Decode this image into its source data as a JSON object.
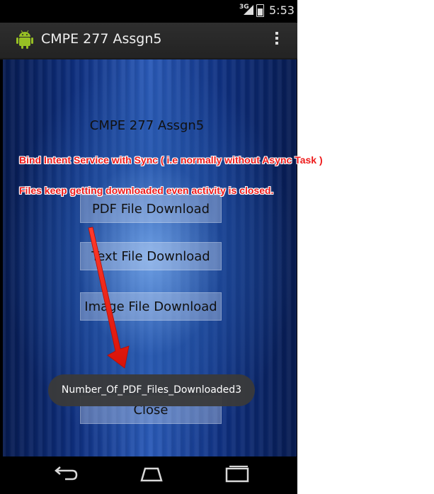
{
  "status_bar": {
    "network": "3G",
    "time": "5:53"
  },
  "action_bar": {
    "title": "CMPE 277 Assgn5"
  },
  "content": {
    "title": "CMPE 277 Assgn5",
    "buttons": {
      "pdf": "PDF File Download",
      "text": "Text File Download",
      "image": "Image File Download",
      "close": "Close"
    }
  },
  "toast": {
    "message": "Number_Of_PDF_Files_Downloaded3"
  },
  "annotations": {
    "line1": "Bind Intent Service with Sync ( i.e normally without Async Task )",
    "line2": "Files keep getting downloaded even activity is closed."
  },
  "colors": {
    "annotation": "#ee1a1a",
    "android_green": "#97c024",
    "background_blue": "#2a5ab8"
  },
  "icons": [
    "android-icon",
    "overflow-menu-icon",
    "back-icon",
    "home-icon",
    "recent-apps-icon",
    "signal-icon",
    "battery-icon"
  ]
}
